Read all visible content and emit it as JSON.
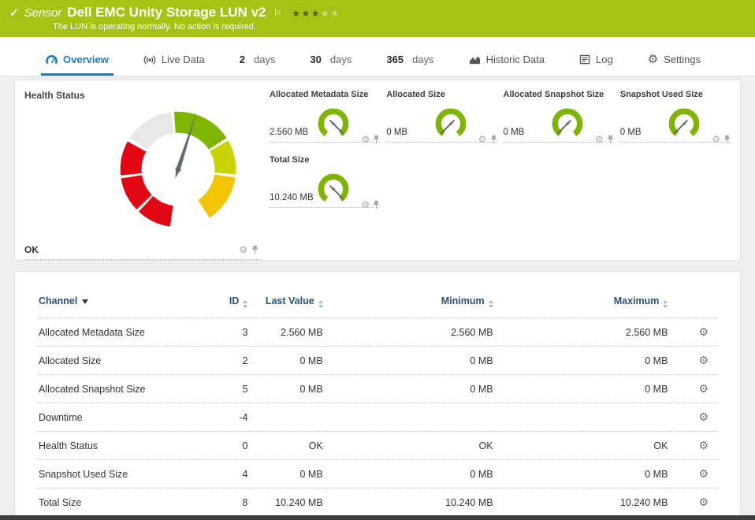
{
  "colors": {
    "header_bg": "#a6c313",
    "accent": "#1f7bc0",
    "gauge_green": "#7db500",
    "gauge_yellowgreen": "#c8d400",
    "gauge_yellow": "#f2c500",
    "gauge_red": "#e30613",
    "gauge_gray": "#e8e8e8",
    "needle": "#5d6a74"
  },
  "icons": {
    "gear": "⚙",
    "check": "✓",
    "flag": "⚐"
  },
  "header": {
    "kind_label": "Sensor",
    "title": "Dell EMC Unity Storage LUN v2",
    "status_message": "The LUN is operating normally. No action is required.",
    "stars_filled": 3,
    "stars_total": 5
  },
  "tabs": [
    {
      "id": "overview",
      "label": "Overview",
      "icon": "overview",
      "icon_name": "gauge-icon",
      "active": true
    },
    {
      "id": "live-data",
      "label": "Live Data",
      "icon": "broadcast",
      "icon_name": "live-signal-icon"
    },
    {
      "id": "2-days",
      "label": "2 days",
      "bold_part": "2",
      "rest": "days"
    },
    {
      "id": "30-days",
      "label": "30 days",
      "bold_part": "30",
      "rest": "days"
    },
    {
      "id": "365-days",
      "label": "365 days",
      "bold_part": "365",
      "rest": "days"
    },
    {
      "id": "historic-data",
      "label": "Historic Data",
      "icon": "area",
      "icon_name": "historic-chart-icon"
    },
    {
      "id": "log",
      "label": "Log",
      "icon": "log",
      "icon_name": "log-icon"
    },
    {
      "id": "settings",
      "label": "Settings",
      "icon": "settings",
      "icon_name": "gear-icon"
    }
  ],
  "health_gauge": {
    "title": "Health Status",
    "value": "OK",
    "needle_angle": 18,
    "segments": [
      {
        "color": "#e8e8e8",
        "start": -57,
        "end": -7
      },
      {
        "color": "#7db500",
        "start": -4,
        "end": 57
      },
      {
        "color": "#c8d400",
        "start": 60,
        "end": 95
      },
      {
        "color": "#f2c500",
        "start": 98,
        "end": 147
      },
      {
        "color": "#e30613",
        "start": 188,
        "end": 223
      },
      {
        "color": "#e30613",
        "start": 226,
        "end": 261
      },
      {
        "color": "#e30613",
        "start": 264,
        "end": 299
      }
    ]
  },
  "mini_gauges": [
    {
      "title": "Allocated Metadata Size",
      "value": "2.560 MB",
      "needle_angle": 135
    },
    {
      "title": "Allocated Size",
      "value": "0 MB",
      "needle_angle": -135
    },
    {
      "title": "Allocated Snapshot Size",
      "value": "0 MB",
      "needle_angle": -135
    },
    {
      "title": "Snapshot Used Size",
      "value": "0 MB",
      "needle_angle": -135
    },
    {
      "title": "Total Size",
      "value": "10.240 MB",
      "needle_angle": 135
    }
  ],
  "table": {
    "headers": [
      {
        "label": "Channel",
        "sort": "active"
      },
      {
        "label": "ID",
        "sort": "both"
      },
      {
        "label": "Last Value",
        "sort": "both"
      },
      {
        "label": "Minimum",
        "sort": "both"
      },
      {
        "label": "Maximum",
        "sort": "both"
      }
    ],
    "rows": [
      {
        "channel": "Allocated Metadata Size",
        "id": "3",
        "last_value": "2.560 MB",
        "minimum": "2.560 MB",
        "maximum": "2.560 MB"
      },
      {
        "channel": "Allocated Size",
        "id": "2",
        "last_value": "0 MB",
        "minimum": "0 MB",
        "maximum": "0 MB"
      },
      {
        "channel": "Allocated Snapshot Size",
        "id": "5",
        "last_value": "0 MB",
        "minimum": "0 MB",
        "maximum": "0 MB"
      },
      {
        "channel": "Downtime",
        "id": "-4",
        "last_value": "",
        "minimum": "",
        "maximum": ""
      },
      {
        "channel": "Health Status",
        "id": "0",
        "last_value": "OK",
        "minimum": "OK",
        "maximum": "OK"
      },
      {
        "channel": "Snapshot Used Size",
        "id": "4",
        "last_value": "0 MB",
        "minimum": "0 MB",
        "maximum": "0 MB"
      },
      {
        "channel": "Total Size",
        "id": "8",
        "last_value": "10.240 MB",
        "minimum": "10.240 MB",
        "maximum": "10.240 MB"
      }
    ]
  }
}
